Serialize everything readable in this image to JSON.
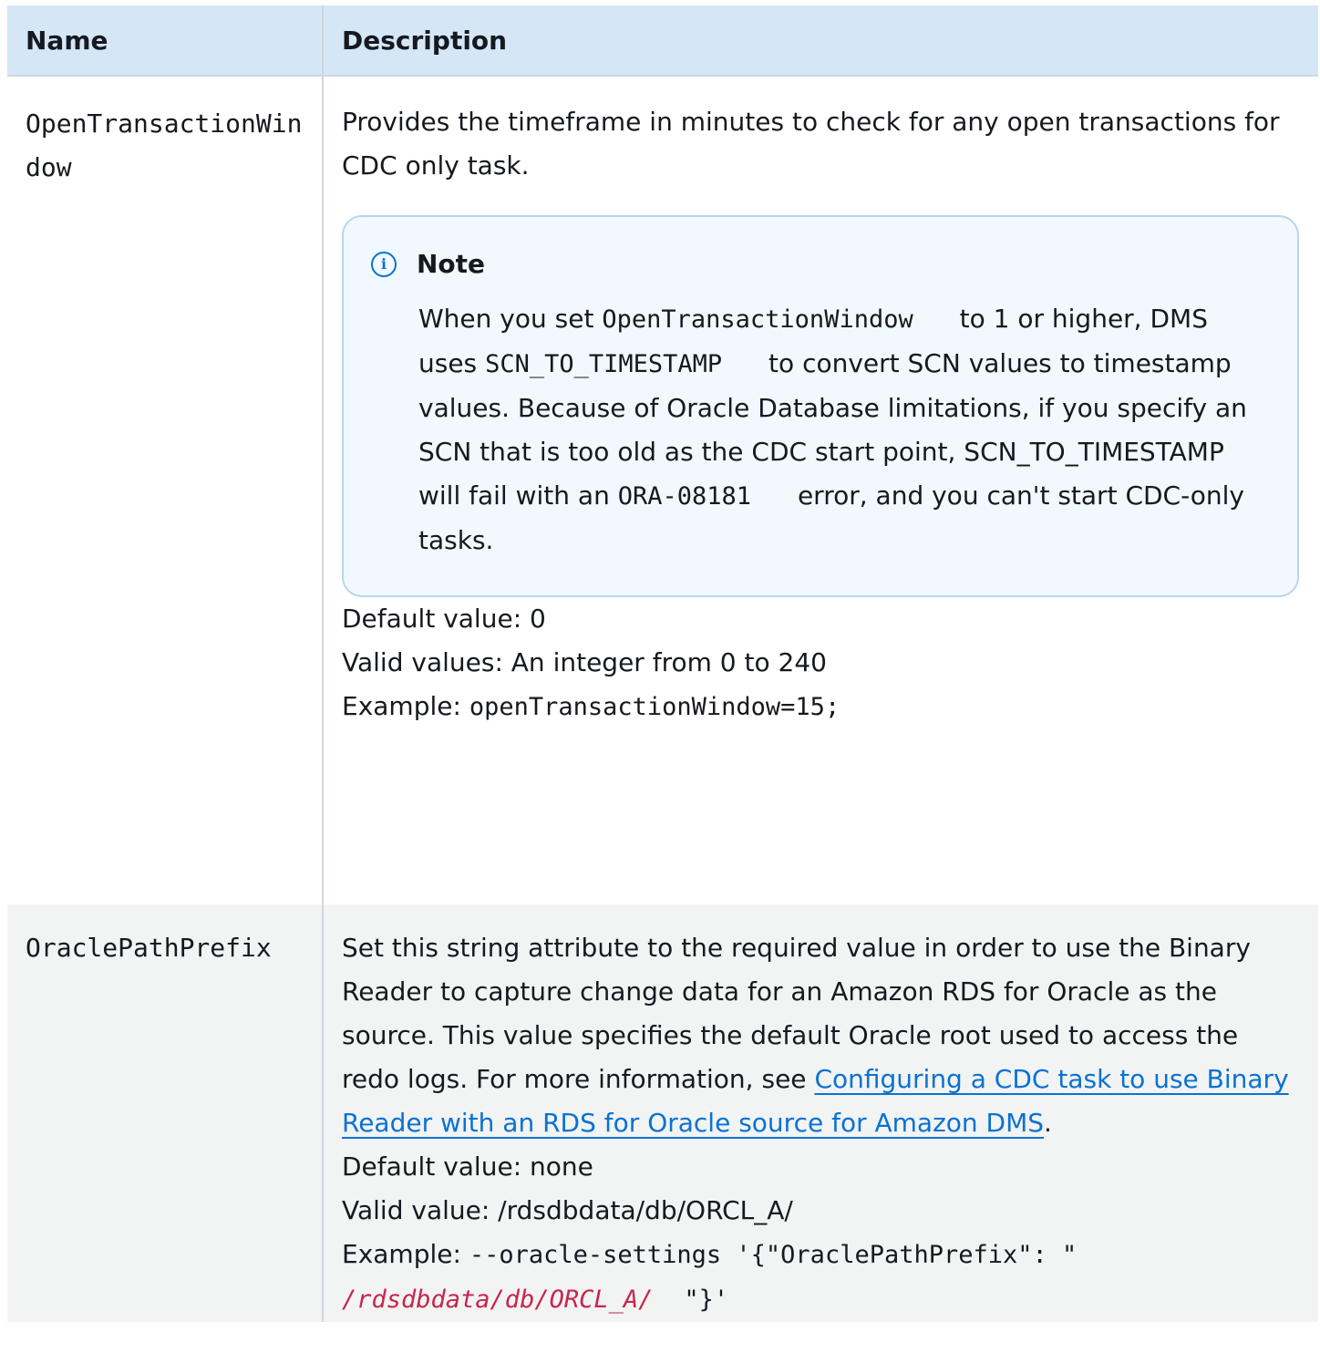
{
  "table": {
    "headers": {
      "name": "Name",
      "description": "Description"
    },
    "rows": [
      {
        "name": "OpenTransactionWindow",
        "description": "Provides the timeframe in minutes to check for any open transactions for CDC only task.",
        "note": {
          "title": "Note",
          "text_1": "When you set ",
          "code_1": "OpenTransactionWindow",
          "text_2": " to 1 or higher, DMS uses ",
          "code_2": "SCN_TO_TIMESTAMP",
          "text_3": " to convert SCN values to timestamp values. Because of Oracle Database limitations, if you specify an SCN that is too old as the CDC start point, SCN_TO_TIMESTAMP will fail with an ",
          "code_3": "ORA-08181",
          "text_4": " error, and you can't start CDC-only tasks."
        },
        "default_value": "Default value: 0",
        "valid_values": "Valid values: An integer from 0 to 240",
        "example_label": "Example: ",
        "example_code": "openTransactionWindow=15;"
      },
      {
        "name": "OraclePathPrefix",
        "description": "Set this string attribute to the required value in order to use the Binary Reader to capture change data for an Amazon RDS for Oracle as the source. This value specifies the default Oracle root used to access the redo logs. For more information, see ",
        "link_text": " Configuring a CDC task to use Binary Reader with an RDS for Oracle source for Amazon DMS",
        "description_end": ".",
        "default_value": "Default value: none",
        "valid_value": "Valid value: /rdsdbdata/db/ORCL_A/",
        "example_label": "Example: ",
        "example_code_1": "--oracle-settings '{\"OraclePathPrefix\": \"",
        "example_code_italic": "/rdsdbdata/db/ORCL_A/",
        "example_code_2": "\"}'"
      }
    ]
  },
  "colors": {
    "header_bg": "#d5e7f7",
    "row_alt_bg": "#f2f3f3",
    "note_bg": "#f1f8fe",
    "note_border": "#b9d5ee",
    "link": "#0972d3",
    "info_icon": "#0972d3",
    "code_italic": "#c7254e"
  },
  "icons": {
    "note_icon": "info-icon"
  }
}
